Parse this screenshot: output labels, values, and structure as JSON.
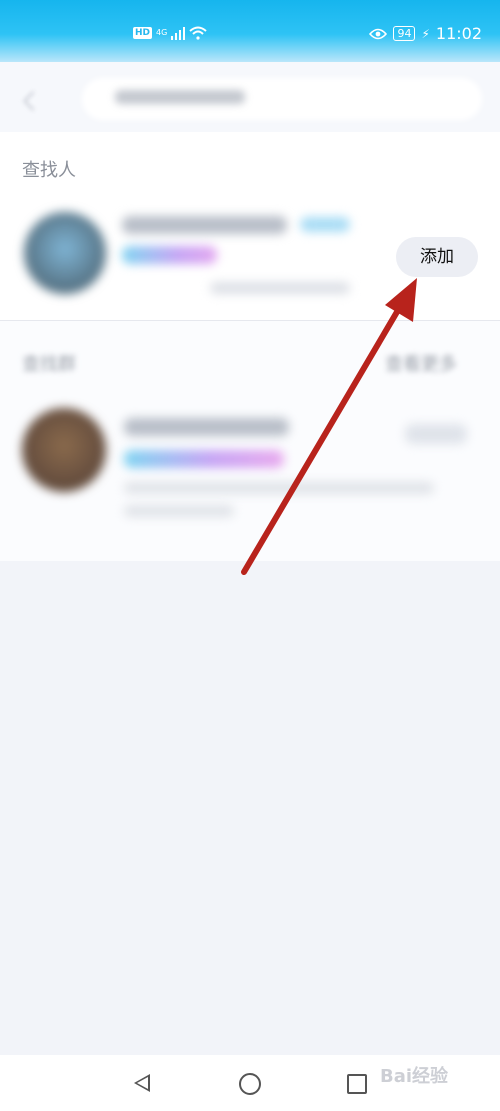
{
  "status_bar": {
    "hd": "HD",
    "network": "4G",
    "battery": "94",
    "time": "11:02"
  },
  "people_section": {
    "title": "查找人",
    "add_button": "添加"
  },
  "groups_section": {
    "title": "查找群",
    "more_link": "查看更多"
  },
  "nav": {
    "back": "back",
    "home": "home",
    "recent": "recent-apps"
  },
  "watermark": "Bai经验",
  "colors": {
    "arrow": "#b8231c",
    "statusbar": "#16b5ee"
  }
}
